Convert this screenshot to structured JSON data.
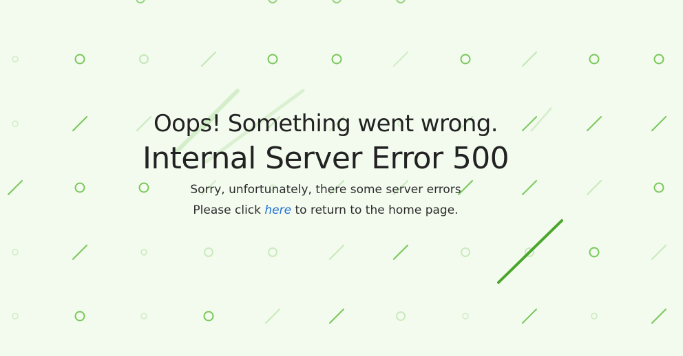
{
  "error": {
    "heading": "Oops! Something went wrong.",
    "title": "Internal Server Error 500",
    "message_line1": "Sorry, unfortunately, there some server errors",
    "message_prefix": "Please click",
    "link_text": "here",
    "message_suffix": "to return to the home page."
  },
  "colors": {
    "background": "#f3fbef",
    "pattern_green": "#6cc24a",
    "accent_line": "#4aa62a",
    "link": "#1f6fd6",
    "text": "#222222"
  }
}
